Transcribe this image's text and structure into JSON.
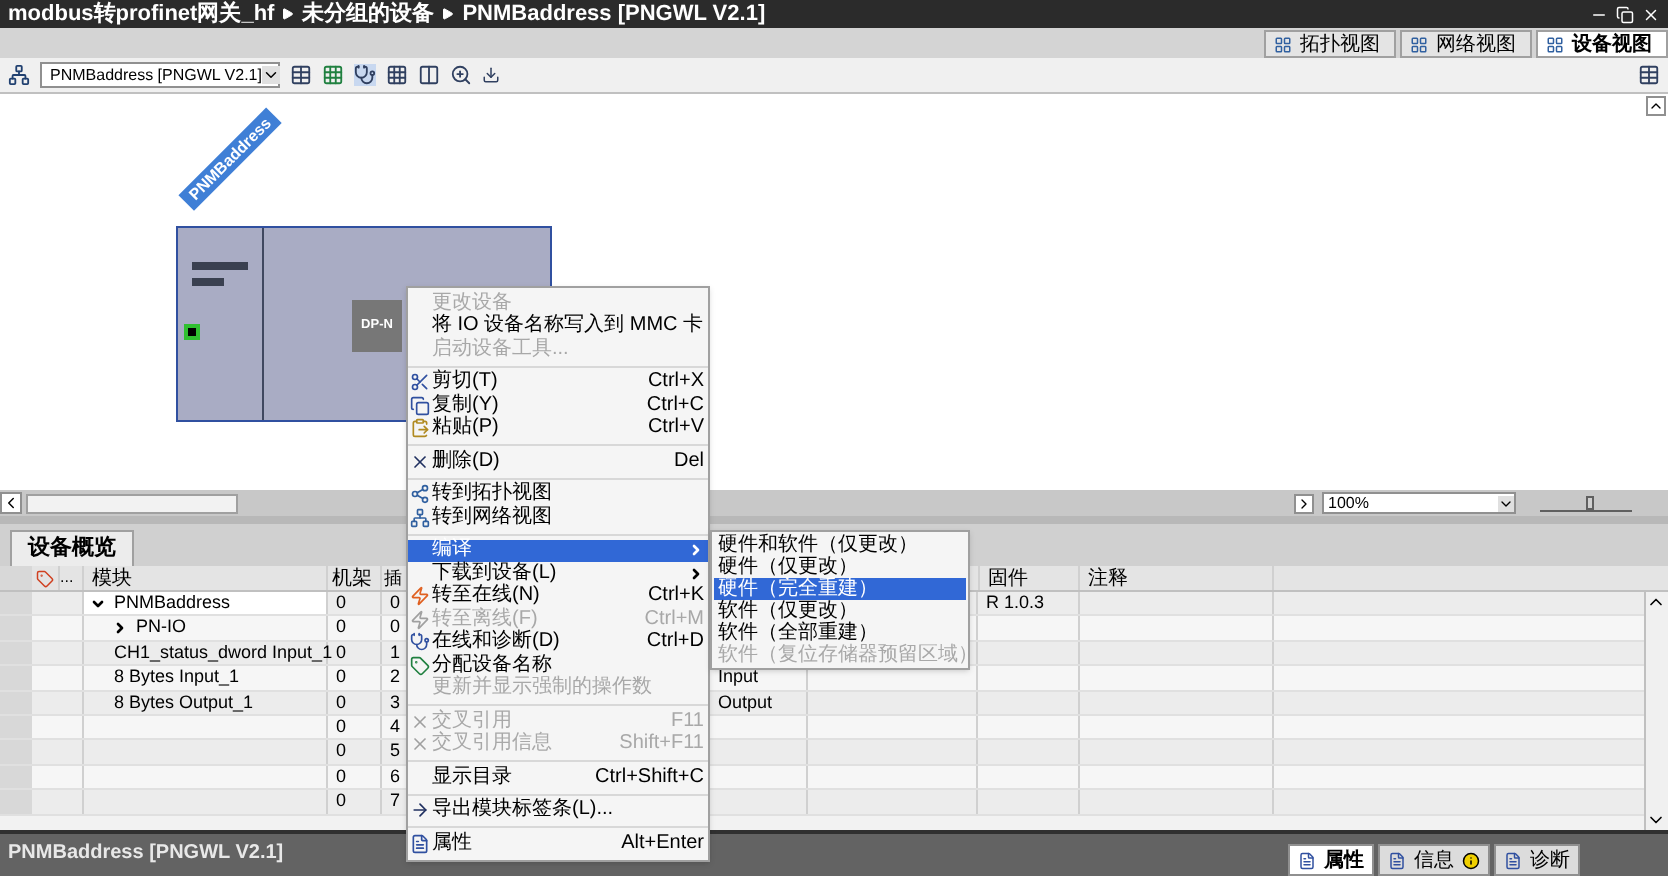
{
  "title_bar": {
    "breadcrumb": [
      "modbus转profinet网关_hf",
      "未分组的设备",
      "PNMBaddress [PNGWL V2.1]"
    ]
  },
  "view_tabs": [
    {
      "label": "拓扑视图",
      "selected": false
    },
    {
      "label": "网络视图",
      "selected": false
    },
    {
      "label": "设备视图",
      "selected": true
    }
  ],
  "toolbar": {
    "device_select": "PNMBaddress [PNGWL V2.1]"
  },
  "canvas": {
    "device_label": "PNMBaddress",
    "module_label": "DP-N"
  },
  "zoom": {
    "value": "100%",
    "level": 0.55
  },
  "panel_tabs": [
    {
      "label": "设备概览",
      "selected": true
    }
  ],
  "table": {
    "header": {
      "ellipsis": "...",
      "module": "模块",
      "rack": "机架",
      "slot": "插",
      "firmware": "固件",
      "comment": "注释"
    },
    "rows": [
      {
        "module": "PNMBaddress",
        "rack": "0",
        "slot": "0",
        "firmware": "R 1.0.3",
        "expanded": true,
        "children": [
          {
            "module": "PN-IO",
            "rack": "0",
            "slot": "0",
            "expanded": false
          }
        ]
      },
      {
        "module": "CH1_status_dword Input_1",
        "rack": "0",
        "slot": "1"
      },
      {
        "module": "8 Bytes Input_1",
        "rack": "0",
        "slot": "2",
        "column_5": "Input"
      },
      {
        "module": "8 Bytes Output_1",
        "rack": "0",
        "slot": "3",
        "column_5": "Output"
      },
      {
        "rack": "0",
        "slot": "4"
      },
      {
        "rack": "0",
        "slot": "5"
      },
      {
        "rack": "0",
        "slot": "6"
      },
      {
        "rack": "0",
        "slot": "7"
      }
    ]
  },
  "context_menu": {
    "groups": [
      [
        {
          "label": "更改设备",
          "disabled": true,
          "selected": false
        },
        {
          "label": "将 IO 设备名称写入到 MMC 卡",
          "disabled": false,
          "selected": false
        },
        {
          "label": "启动设备工具...",
          "disabled": true,
          "selected": false
        }
      ],
      [
        {
          "label": "剪切(T)",
          "shortcut": "Ctrl+X",
          "disabled": false,
          "selected": false
        },
        {
          "label": "复制(Y)",
          "shortcut": "Ctrl+C",
          "disabled": false,
          "selected": false
        },
        {
          "label": "粘贴(P)",
          "shortcut": "Ctrl+V",
          "disabled": false,
          "selected": false
        }
      ],
      [
        {
          "label": "删除(D)",
          "shortcut": "Del",
          "disabled": false,
          "selected": false
        }
      ],
      [
        {
          "label": "转到拓扑视图",
          "disabled": false,
          "selected": false
        },
        {
          "label": "转到网络视图",
          "disabled": false,
          "selected": false
        }
      ],
      [
        {
          "label": "编译",
          "submenu": true,
          "disabled": false,
          "selected": true
        },
        {
          "label": "下载到设备(L)",
          "submenu": true,
          "disabled": false,
          "selected": false
        },
        {
          "label": "转至在线(N)",
          "shortcut": "Ctrl+K",
          "disabled": false,
          "selected": false
        },
        {
          "label": "转至离线(F)",
          "shortcut": "Ctrl+M",
          "disabled": true,
          "selected": false
        },
        {
          "label": "在线和诊断(D)",
          "shortcut": "Ctrl+D",
          "disabled": false,
          "selected": false
        },
        {
          "label": "分配设备名称",
          "disabled": false,
          "selected": false
        },
        {
          "label": "更新并显示强制的操作数",
          "disabled": true,
          "selected": false
        }
      ],
      [
        {
          "label": "交叉引用",
          "shortcut": "F11",
          "disabled": true,
          "selected": false
        },
        {
          "label": "交叉引用信息",
          "shortcut": "Shift+F11",
          "disabled": true,
          "selected": false
        }
      ],
      [
        {
          "label": "显示目录",
          "shortcut": "Ctrl+Shift+C",
          "disabled": false,
          "selected": false
        }
      ],
      [
        {
          "label": "导出模块标签条(L)...",
          "disabled": false,
          "selected": false
        }
      ],
      [
        {
          "label": "属性",
          "shortcut": "Alt+Enter",
          "disabled": false,
          "selected": false
        }
      ]
    ]
  },
  "submenu": [
    {
      "label": "硬件和软件（仅更改）",
      "disabled": false,
      "selected": false
    },
    {
      "label": "硬件（仅更改）",
      "disabled": false,
      "selected": false
    },
    {
      "label": "硬件（完全重建）",
      "disabled": false,
      "selected": true
    },
    {
      "label": "软件（仅更改）",
      "disabled": false,
      "selected": false
    },
    {
      "label": "软件（全部重建）",
      "disabled": false,
      "selected": false
    },
    {
      "label": "软件（复位存储器预留区域）",
      "disabled": true,
      "selected": false
    }
  ],
  "status_bar": {
    "title": "PNMBaddress [PNGWL V2.1]"
  },
  "bottom_tabs": [
    {
      "label": "属性",
      "selected": true
    },
    {
      "label": "信息",
      "selected": false
    },
    {
      "label": "诊断",
      "selected": false
    }
  ]
}
